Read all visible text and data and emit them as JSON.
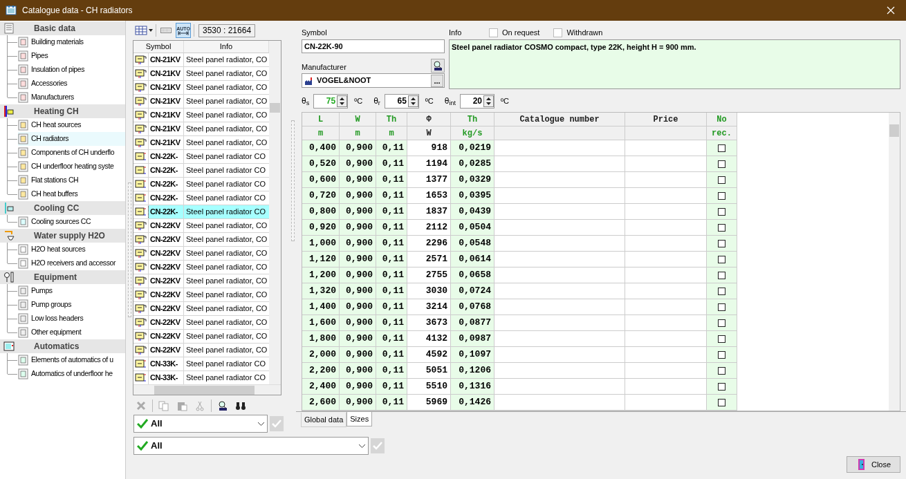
{
  "window": {
    "title": "Catalogue data - CH radiators"
  },
  "sidebar": {
    "groups": [
      {
        "label": "Basic data",
        "children": [
          {
            "label": "Building materials",
            "selected": false
          },
          {
            "label": "Pipes",
            "selected": false
          },
          {
            "label": "Insulation of pipes",
            "selected": false
          },
          {
            "label": "Accessories",
            "selected": false
          },
          {
            "label": "Manufacturers",
            "selected": false
          }
        ]
      },
      {
        "label": "Heating CH",
        "children": [
          {
            "label": "CH heat sources",
            "selected": false
          },
          {
            "label": "CH radiators",
            "selected": true
          },
          {
            "label": "Components of CH underflo",
            "selected": false
          },
          {
            "label": "CH underfloor heating syste",
            "selected": false
          },
          {
            "label": "Flat stations CH",
            "selected": false
          },
          {
            "label": "CH heat buffers",
            "selected": false
          }
        ]
      },
      {
        "label": "Cooling CC",
        "children": [
          {
            "label": "Cooling sources CC",
            "selected": false
          }
        ]
      },
      {
        "label": "Water supply H2O",
        "children": [
          {
            "label": "H2O heat sources",
            "selected": false
          },
          {
            "label": "H2O receivers and accessor",
            "selected": false
          }
        ]
      },
      {
        "label": "Equipment",
        "children": [
          {
            "label": "Pumps",
            "selected": false
          },
          {
            "label": "Pump groups",
            "selected": false
          },
          {
            "label": "Low loss headers",
            "selected": false
          },
          {
            "label": "Other equipment",
            "selected": false
          }
        ]
      },
      {
        "label": "Automatics",
        "children": [
          {
            "label": "Elements of automatics of u",
            "selected": false
          },
          {
            "label": "Automatics of underfloor he",
            "selected": false
          }
        ]
      }
    ]
  },
  "list_toolbar": {
    "auto_label": "AUTO",
    "auto_on": true,
    "counter": "3530 : 21664"
  },
  "list": {
    "columns": [
      "Symbol",
      "Info"
    ],
    "rows": [
      {
        "kind": "valve",
        "symbol": "CN-21KV",
        "info": "Steel panel radiator, CO",
        "selected": false
      },
      {
        "kind": "valve",
        "symbol": "CN-21KV",
        "info": "Steel panel radiator, CO",
        "selected": false
      },
      {
        "kind": "valve",
        "symbol": "CN-21KV",
        "info": "Steel panel radiator, CO",
        "selected": false
      },
      {
        "kind": "valve",
        "symbol": "CN-21KV",
        "info": "Steel panel radiator, CO",
        "selected": false
      },
      {
        "kind": "valve",
        "symbol": "CN-21KV",
        "info": "Steel panel radiator, CO",
        "selected": false
      },
      {
        "kind": "valve",
        "symbol": "CN-21KV",
        "info": "Steel panel radiator, CO",
        "selected": false
      },
      {
        "kind": "valve",
        "symbol": "CN-21KV",
        "info": "Steel panel radiator, CO",
        "selected": false
      },
      {
        "kind": "side",
        "symbol": "CN-22K-",
        "info": "Steel panel radiator CO",
        "selected": false
      },
      {
        "kind": "side",
        "symbol": "CN-22K-",
        "info": "Steel panel radiator CO",
        "selected": false
      },
      {
        "kind": "side",
        "symbol": "CN-22K-",
        "info": "Steel panel radiator CO",
        "selected": false
      },
      {
        "kind": "side",
        "symbol": "CN-22K-",
        "info": "Steel panel radiator CO",
        "selected": false
      },
      {
        "kind": "side",
        "symbol": "CN-22K-",
        "info": "Steel panel radiator CO",
        "selected": true
      },
      {
        "kind": "valve",
        "symbol": "CN-22KV",
        "info": "Steel panel radiator, CO",
        "selected": false
      },
      {
        "kind": "valve",
        "symbol": "CN-22KV",
        "info": "Steel panel radiator, CO",
        "selected": false
      },
      {
        "kind": "valve",
        "symbol": "CN-22KV",
        "info": "Steel panel radiator, CO",
        "selected": false
      },
      {
        "kind": "valve",
        "symbol": "CN-22KV",
        "info": "Steel panel radiator, CO",
        "selected": false
      },
      {
        "kind": "valve",
        "symbol": "CN-22KV",
        "info": "Steel panel radiator, CO",
        "selected": false
      },
      {
        "kind": "valve",
        "symbol": "CN-22KV",
        "info": "Steel panel radiator, CO",
        "selected": false
      },
      {
        "kind": "valve",
        "symbol": "CN-22KV",
        "info": "Steel panel radiator, CO",
        "selected": false
      },
      {
        "kind": "valve",
        "symbol": "CN-22KV",
        "info": "Steel panel radiator, CO",
        "selected": false
      },
      {
        "kind": "valve",
        "symbol": "CN-22KV",
        "info": "Steel panel radiator, CO",
        "selected": false
      },
      {
        "kind": "valve",
        "symbol": "CN-22KV",
        "info": "Steel panel radiator, CO",
        "selected": false
      },
      {
        "kind": "side",
        "symbol": "CN-33K-",
        "info": "Steel panel radiator CO",
        "selected": false
      },
      {
        "kind": "side",
        "symbol": "CN-33K-",
        "info": "Steel panel radiator CO",
        "selected": false
      }
    ]
  },
  "action_toolbar": [
    {
      "kind": "delete",
      "disabled": true
    },
    {
      "kind": "copy",
      "disabled": true
    },
    {
      "kind": "paste",
      "disabled": true
    },
    {
      "kind": "cut",
      "disabled": true
    },
    {
      "kind": "find",
      "disabled": false
    },
    {
      "kind": "binoculars",
      "disabled": false
    }
  ],
  "filters": [
    {
      "value": "All",
      "apply_disabled": true
    },
    {
      "value": "All",
      "apply_disabled": true
    }
  ],
  "details": {
    "symbol_label": "Symbol",
    "symbol": "CN-22K-90",
    "info_label": "Info",
    "info": "Steel panel radiator COSMO compact, type 22K, height H = 900 mm.",
    "options": [
      {
        "label": "On request",
        "checked": false
      },
      {
        "label": "Withdrawn",
        "checked": false
      }
    ],
    "manufacturer_label": "Manufacturer",
    "manufacturer": "VOGEL&NOOT",
    "browse": "...",
    "temperatures": [
      {
        "label": "θ$_{s}$",
        "value": "75",
        "unit": "ºC",
        "highlighted": true
      },
      {
        "label": "θ$_{r}$",
        "value": "65",
        "unit": "ºC",
        "highlighted": false
      },
      {
        "label": "θ$_{int}$",
        "value": "20",
        "unit": "ºC",
        "highlighted": false
      }
    ]
  },
  "sizes_table": {
    "columns": [
      {
        "title": "L",
        "unit": "m",
        "kind": "input"
      },
      {
        "title": "W",
        "unit": "m",
        "kind": "input"
      },
      {
        "title": "Th",
        "unit": "m",
        "kind": "input"
      },
      {
        "title": "Φ",
        "unit": "W",
        "kind": "output"
      },
      {
        "title": "Th",
        "unit": "kg/s",
        "kind": "input"
      },
      {
        "title": "Catalogue number",
        "kind": "output"
      },
      {
        "title": "Price",
        "kind": "output"
      },
      {
        "title": "No",
        "unit": "rec.",
        "kind": "input"
      }
    ],
    "rows": [
      {
        "cells": [
          "0,400",
          "0,900",
          "0,11",
          "918",
          "0,0219",
          "",
          ""
        ],
        "no_rec": false
      },
      {
        "cells": [
          "0,520",
          "0,900",
          "0,11",
          "1194",
          "0,0285",
          "",
          ""
        ],
        "no_rec": false
      },
      {
        "cells": [
          "0,600",
          "0,900",
          "0,11",
          "1377",
          "0,0329",
          "",
          ""
        ],
        "no_rec": false
      },
      {
        "cells": [
          "0,720",
          "0,900",
          "0,11",
          "1653",
          "0,0395",
          "",
          ""
        ],
        "no_rec": false
      },
      {
        "cells": [
          "0,800",
          "0,900",
          "0,11",
          "1837",
          "0,0439",
          "",
          ""
        ],
        "no_rec": false
      },
      {
        "cells": [
          "0,920",
          "0,900",
          "0,11",
          "2112",
          "0,0504",
          "",
          ""
        ],
        "no_rec": false
      },
      {
        "cells": [
          "1,000",
          "0,900",
          "0,11",
          "2296",
          "0,0548",
          "",
          ""
        ],
        "no_rec": false
      },
      {
        "cells": [
          "1,120",
          "0,900",
          "0,11",
          "2571",
          "0,0614",
          "",
          ""
        ],
        "no_rec": false
      },
      {
        "cells": [
          "1,200",
          "0,900",
          "0,11",
          "2755",
          "0,0658",
          "",
          ""
        ],
        "no_rec": false
      },
      {
        "cells": [
          "1,320",
          "0,900",
          "0,11",
          "3030",
          "0,0724",
          "",
          ""
        ],
        "no_rec": false
      },
      {
        "cells": [
          "1,400",
          "0,900",
          "0,11",
          "3214",
          "0,0768",
          "",
          ""
        ],
        "no_rec": false
      },
      {
        "cells": [
          "1,600",
          "0,900",
          "0,11",
          "3673",
          "0,0877",
          "",
          ""
        ],
        "no_rec": false
      },
      {
        "cells": [
          "1,800",
          "0,900",
          "0,11",
          "4132",
          "0,0987",
          "",
          ""
        ],
        "no_rec": false
      },
      {
        "cells": [
          "2,000",
          "0,900",
          "0,11",
          "4592",
          "0,1097",
          "",
          ""
        ],
        "no_rec": false
      },
      {
        "cells": [
          "2,200",
          "0,900",
          "0,11",
          "5051",
          "0,1206",
          "",
          ""
        ],
        "no_rec": false
      },
      {
        "cells": [
          "2,400",
          "0,900",
          "0,11",
          "5510",
          "0,1316",
          "",
          ""
        ],
        "no_rec": false
      },
      {
        "cells": [
          "2,600",
          "0,900",
          "0,11",
          "5969",
          "0,1426",
          "",
          ""
        ],
        "no_rec": false
      }
    ]
  },
  "tabs": [
    {
      "label": "Global data",
      "selected": false
    },
    {
      "label": "Sizes",
      "selected": true
    }
  ],
  "close_button": "Close"
}
